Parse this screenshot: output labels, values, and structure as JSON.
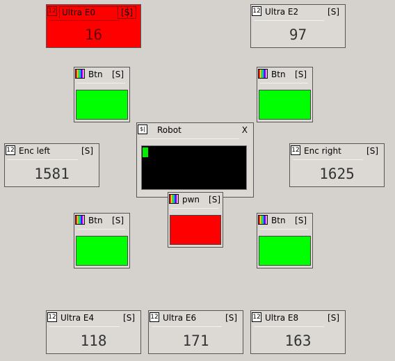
{
  "colors": {
    "background": "#d5d1cd",
    "alarm": "#ff0000",
    "on": "#00ff00",
    "progress_track": "#000000"
  },
  "ultra_e0": {
    "icon": "12",
    "title": "Ultra E0",
    "tag": "[S]",
    "value": "16",
    "state": "alarm"
  },
  "ultra_e2": {
    "icon": "12",
    "title": "Ultra E2",
    "tag": "[S]",
    "value": "97"
  },
  "enc_left": {
    "icon": "12",
    "title": "Enc left",
    "tag": "[S]",
    "value": "1581"
  },
  "enc_right": {
    "icon": "12",
    "title": "Enc right",
    "tag": "[S]",
    "value": "1625"
  },
  "ultra_e4": {
    "icon": "12",
    "title": "Ultra E4",
    "tag": "[S]",
    "value": "118"
  },
  "ultra_e6": {
    "icon": "12",
    "title": "Ultra E6",
    "tag": "[S]",
    "value": "171"
  },
  "ultra_e8": {
    "icon": "12",
    "title": "Ultra E8",
    "tag": "[S]",
    "value": "163"
  },
  "btn_top_left": {
    "icon": "palette-icon",
    "title": "Btn",
    "tag": "[S]",
    "color": "#00ff00"
  },
  "btn_top_right": {
    "icon": "palette-icon",
    "title": "Btn",
    "tag": "[S]",
    "color": "#00ff00"
  },
  "btn_bottom_left": {
    "icon": "palette-icon",
    "title": "Btn",
    "tag": "[S]",
    "color": "#00ff00"
  },
  "btn_bottom_right": {
    "icon": "palette-icon",
    "title": "Btn",
    "tag": "[S]",
    "color": "#00ff00"
  },
  "pwn": {
    "icon": "palette-icon",
    "title": "pwn",
    "tag": "[S]",
    "color": "#ff0000"
  },
  "robot": {
    "icon": "$|",
    "title": "Robot",
    "close": "X",
    "progress_fraction": 0.05
  }
}
